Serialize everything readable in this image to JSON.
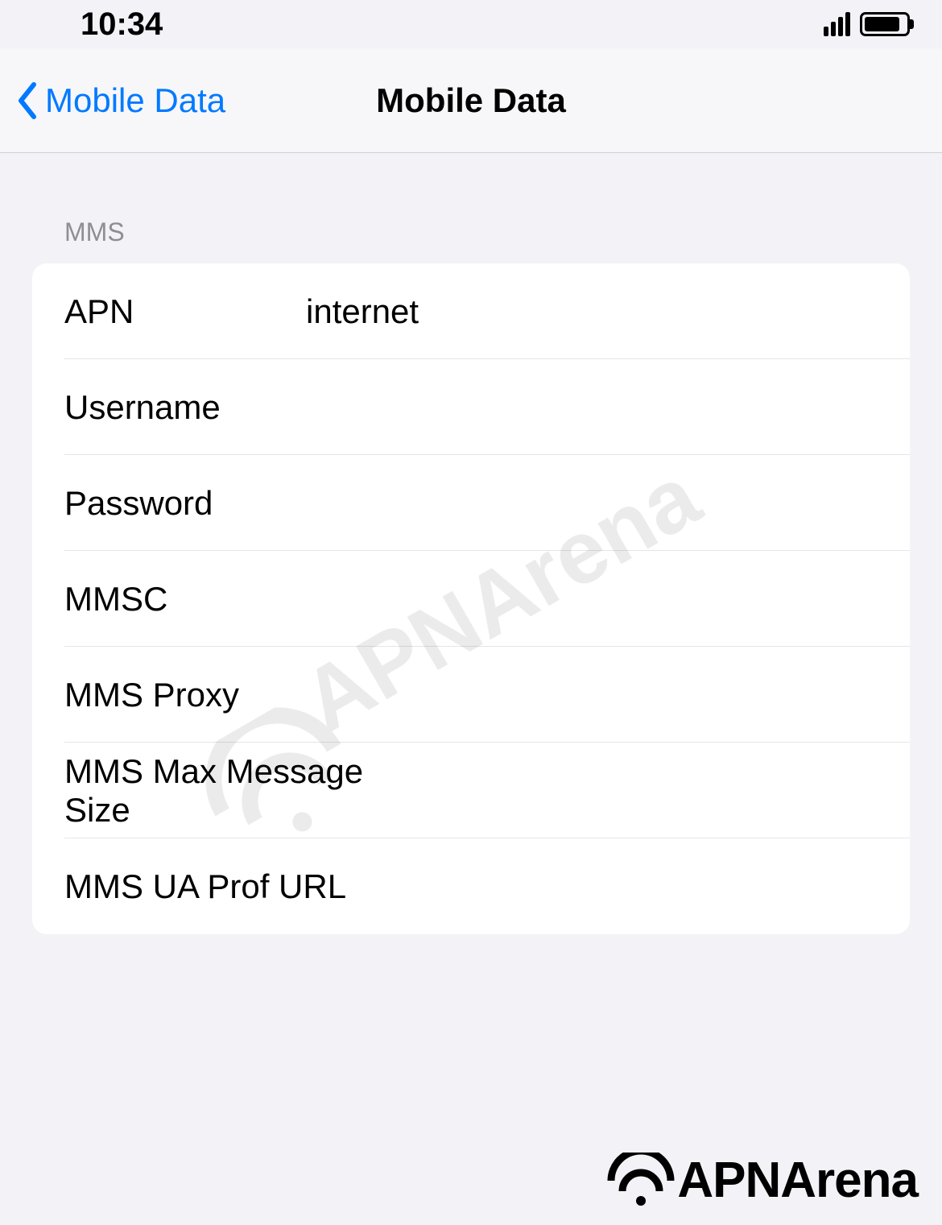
{
  "statusBar": {
    "time": "10:34"
  },
  "nav": {
    "backLabel": "Mobile Data",
    "title": "Mobile Data"
  },
  "section": {
    "header": "MMS"
  },
  "fields": {
    "apn": {
      "label": "APN",
      "value": "internet"
    },
    "username": {
      "label": "Username",
      "value": ""
    },
    "password": {
      "label": "Password",
      "value": ""
    },
    "mmsc": {
      "label": "MMSC",
      "value": ""
    },
    "mmsProxy": {
      "label": "MMS Proxy",
      "value": ""
    },
    "mmsMaxSize": {
      "label": "MMS Max Message Size",
      "value": ""
    },
    "mmsUaProf": {
      "label": "MMS UA Prof URL",
      "value": ""
    }
  },
  "watermark": {
    "text": "APNArena"
  },
  "brand": {
    "text": "APNArena"
  }
}
